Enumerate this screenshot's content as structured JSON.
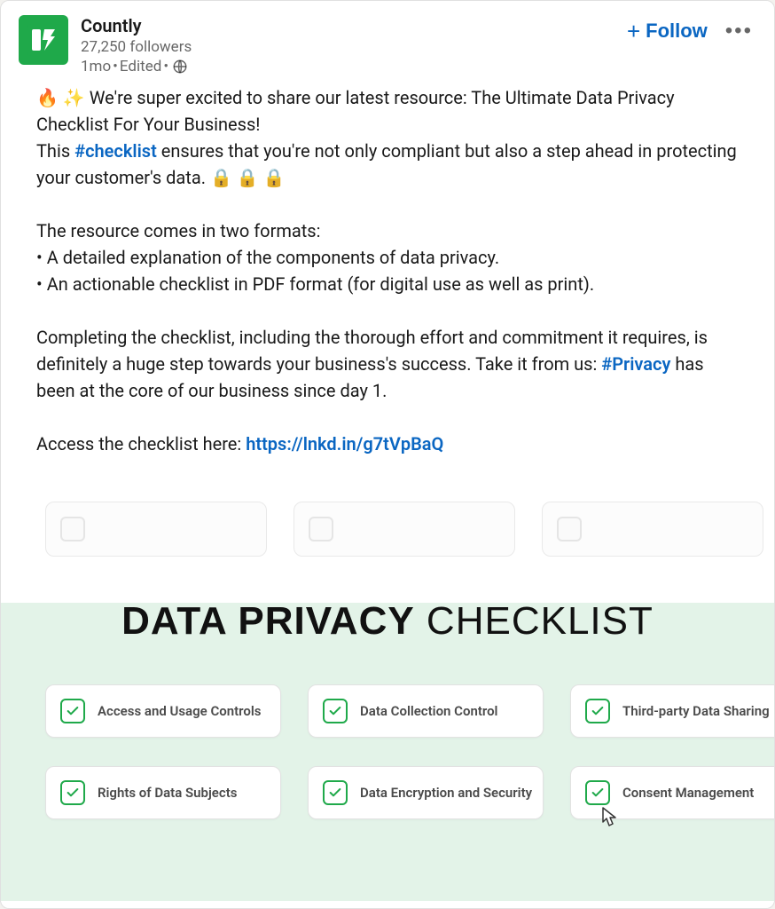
{
  "header": {
    "author_name": "Countly",
    "followers": "27,250 followers",
    "age": "1mo",
    "separator": " • ",
    "edited": "Edited",
    "follow_label": "Follow"
  },
  "body": {
    "p1_prefix": "🔥 ✨ We're super excited to share our latest resource: The Ultimate Data Privacy Checklist For Your Business!",
    "p2_prefix": "This ",
    "p2_hashtag": "#checklist",
    "p2_suffix": " ensures that you're not only compliant but also a step ahead in protecting your customer's data. 🔒 🔒 🔒",
    "p3": "The resource comes in two formats:",
    "p4": "• A detailed explanation of the components of data privacy.",
    "p5": "• An actionable checklist in PDF format (for digital use as well as print).",
    "p6_prefix": "Completing the checklist, including the thorough effort and commitment it requires, is definitely a huge step towards your business's success. Take it from us: ",
    "p6_hashtag": "#Privacy",
    "p6_suffix": " has been at the core of our business since day 1.",
    "p7_prefix": "Access the checklist here: ",
    "p7_link": "https://lnkd.in/g7tVpBaQ"
  },
  "promo": {
    "title_bold": "DATA PRIVACY",
    "title_rest": " CHECKLIST",
    "items": {
      "0": "Access and Usage Controls",
      "1": "Data Collection Control",
      "2": "Third-party Data Sharing",
      "3": "Rights of Data Subjects",
      "4": "Data Encryption and Security",
      "5": "Consent Management"
    }
  }
}
